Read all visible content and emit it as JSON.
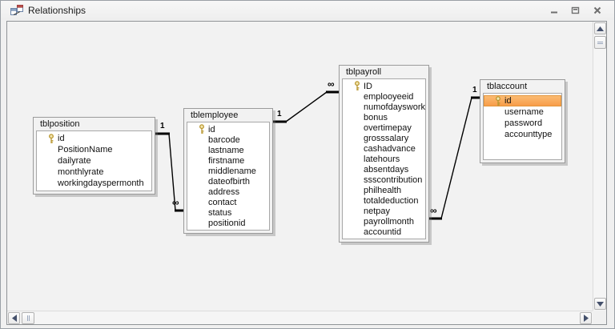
{
  "window": {
    "title": "Relationships",
    "controls": {
      "minimize": "minimize",
      "restore": "restore",
      "close": "close"
    }
  },
  "colors": {
    "selection_top": "#FBBE76",
    "selection_bottom": "#F79A46",
    "line": "#000000",
    "key_gold": "#b8962e"
  },
  "diagram": {
    "tables": [
      {
        "id": "tblposition",
        "title": "tblposition",
        "fields": [
          {
            "name": "id",
            "key": true
          },
          {
            "name": "PositionName"
          },
          {
            "name": "dailyrate"
          },
          {
            "name": "monthlyrate"
          },
          {
            "name": "workingdayspermonth"
          }
        ]
      },
      {
        "id": "tblemployee",
        "title": "tblemployee",
        "fields": [
          {
            "name": "id",
            "key": true
          },
          {
            "name": "barcode"
          },
          {
            "name": "lastname"
          },
          {
            "name": "firstname"
          },
          {
            "name": "middlename"
          },
          {
            "name": "dateofbirth"
          },
          {
            "name": "address"
          },
          {
            "name": "contact"
          },
          {
            "name": "status"
          },
          {
            "name": "positionid"
          }
        ]
      },
      {
        "id": "tblpayroll",
        "title": "tblpayroll",
        "fields": [
          {
            "name": "ID",
            "key": true
          },
          {
            "name": "emplooyeeid"
          },
          {
            "name": "numofdayswork"
          },
          {
            "name": "bonus"
          },
          {
            "name": "overtimepay"
          },
          {
            "name": "grosssalary"
          },
          {
            "name": "cashadvance"
          },
          {
            "name": "latehours"
          },
          {
            "name": "absentdays"
          },
          {
            "name": "ssscontribution"
          },
          {
            "name": "philhealth"
          },
          {
            "name": "totaldeduction"
          },
          {
            "name": "netpay"
          },
          {
            "name": "payrollmonth"
          },
          {
            "name": "accountid"
          }
        ]
      },
      {
        "id": "tblaccount",
        "title": "tblaccount",
        "fields": [
          {
            "name": "id",
            "key": true,
            "selected": true
          },
          {
            "name": "username"
          },
          {
            "name": "password"
          },
          {
            "name": "accounttype"
          }
        ]
      }
    ],
    "relationships": [
      {
        "from": "tblposition",
        "from_label": "1",
        "to": "tblemployee",
        "to_label": "∞"
      },
      {
        "from": "tblemployee",
        "from_label": "1",
        "to": "tblpayroll",
        "to_label": "∞"
      },
      {
        "from": "tblaccount",
        "from_label": "1",
        "to": "tblpayroll",
        "to_label": "∞"
      }
    ]
  }
}
